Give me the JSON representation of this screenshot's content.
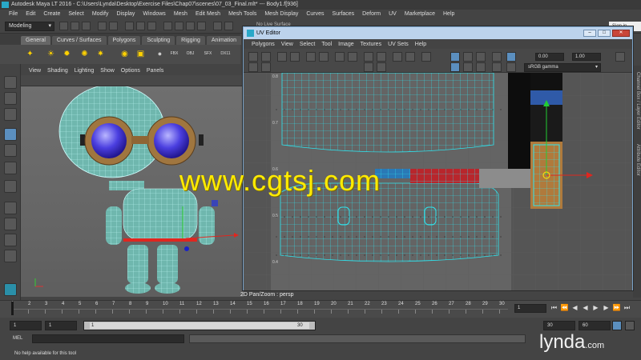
{
  "maya": {
    "window_title": "Autodesk Maya LT 2016 - C:\\Users\\Lynda\\Desktop\\Exercise Files\\Chap07\\scenes\\07_03_Final.mlt*   ---   Body1.f[936]",
    "menus": [
      "File",
      "Edit",
      "Create",
      "Select",
      "Modify",
      "Display",
      "Windows",
      "Mesh",
      "Edit Mesh",
      "Mesh Tools",
      "Mesh Display",
      "Curves",
      "Surfaces",
      "Deform",
      "UV",
      "Marketplace",
      "Help"
    ],
    "mode": "Modeling",
    "signin_placeholder": "Sign in",
    "live_surface": "No Live Surface"
  },
  "shelf": {
    "tabs": [
      "General",
      "Curves / Surfaces",
      "Polygons",
      "Sculpting",
      "Rigging",
      "Animation"
    ],
    "active_tab_index": 0,
    "icon_labels": [
      "FBX",
      "OBJ",
      "SFX",
      "DX11"
    ]
  },
  "viewport": {
    "menus": [
      "View",
      "Shading",
      "Lighting",
      "Show",
      "Options",
      "Panels"
    ],
    "label": "2D Pan/Zoom : persp"
  },
  "uv_editor": {
    "title": "UV Editor",
    "menus": [
      "Polygons",
      "View",
      "Select",
      "Tool",
      "Image",
      "Textures",
      "UV Sets",
      "Help"
    ],
    "exposure": "0.00",
    "gamma": "1.00",
    "color_space": "sRGB gamma",
    "grid_labels": [
      "0.8",
      "0.7",
      "0.6",
      "0.5",
      "0.4"
    ]
  },
  "side_tabs": [
    "Channel Box / Layer Editor",
    "Attribute Editor"
  ],
  "timeline": {
    "ticks": [
      "1",
      "2",
      "3",
      "4",
      "5",
      "6",
      "7",
      "8",
      "9",
      "10",
      "11",
      "12",
      "13",
      "14",
      "15",
      "16",
      "17",
      "18",
      "19",
      "20",
      "21",
      "22",
      "23",
      "24",
      "25",
      "26",
      "27",
      "28",
      "29",
      "30"
    ],
    "current_frame": "1"
  },
  "range": {
    "start": "1",
    "playback_start": "1",
    "slider_start": "1",
    "slider_end": "30",
    "playback_end": "30",
    "end": "60"
  },
  "command_line": {
    "label": "MEL",
    "help": "No help available for this tool"
  },
  "overlays": {
    "watermark": "www.cgtsj.com",
    "logo": "lynda",
    "logo_suffix": ".com"
  },
  "colors": {
    "maya_accent": "#29a8c8",
    "uv_title_bg": "#bcd3ec",
    "watermark": "#ffeb00",
    "uv_wire": "#2ee6f0",
    "tool_active": "#5b8fbf"
  }
}
